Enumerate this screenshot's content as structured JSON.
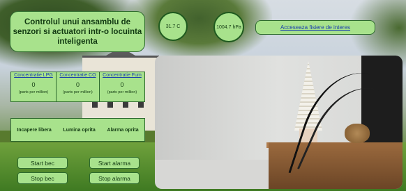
{
  "header": {
    "title": "Controlul unui ansamblu de senzori si actuatori intr-o locuinta inteligenta"
  },
  "readings": {
    "temperature": "31.7 C",
    "pressure": "1004.7 hPa"
  },
  "link": {
    "label": "Acceseaza fisiere de interes"
  },
  "sensors": [
    {
      "label": "Concentratie LPG",
      "value": "0",
      "unit": "(parts per million)"
    },
    {
      "label": "Concentratie CO",
      "value": "0",
      "unit": "(parts per million)"
    },
    {
      "label": "Concentratie Fum",
      "value": "0",
      "unit": "(parts per million)"
    }
  ],
  "status": {
    "room": "Incapere libera",
    "light": "Lumina oprita",
    "alarm": "Alarma oprita"
  },
  "buttons": {
    "start_light": "Start bec",
    "stop_light": "Stop bec",
    "start_alarm": "Start alarma",
    "stop_alarm": "Stop alarma"
  },
  "colors": {
    "panel": "#a8e28c",
    "border": "#2e6b2e",
    "link": "#1a3fae"
  }
}
